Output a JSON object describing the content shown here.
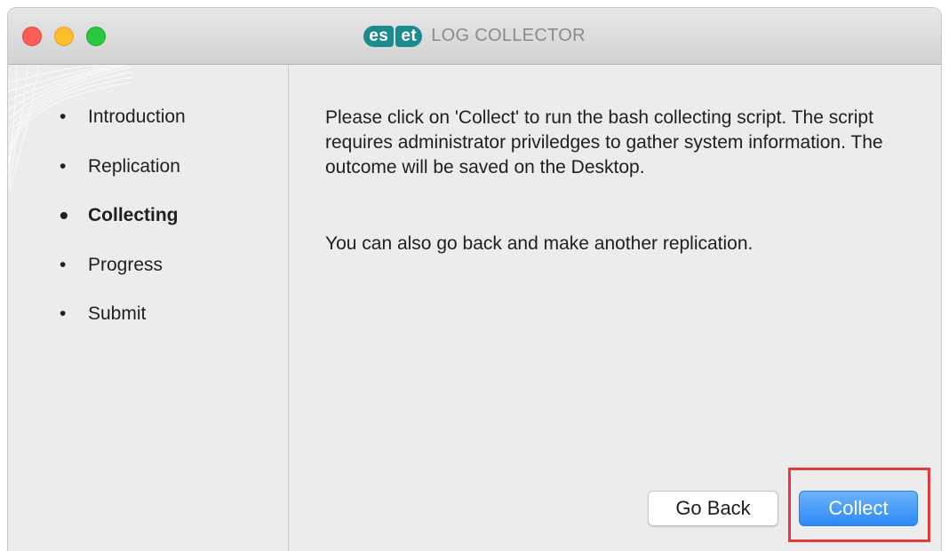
{
  "window": {
    "title": "LOG COLLECTOR",
    "logo": {
      "part1": "es",
      "part2": "et",
      "color": "#1b8b8e"
    }
  },
  "sidebar": {
    "steps": [
      {
        "label": "Introduction",
        "active": false
      },
      {
        "label": "Replication",
        "active": false
      },
      {
        "label": "Collecting",
        "active": true
      },
      {
        "label": "Progress",
        "active": false
      },
      {
        "label": "Submit",
        "active": false
      }
    ]
  },
  "content": {
    "paragraph1": "Please click on 'Collect' to run the bash collecting script. The script requires administrator priviledges to gather system information. The outcome will be saved on the Desktop.",
    "paragraph2": "You can also go back and make another replication."
  },
  "buttons": {
    "back_label": "Go Back",
    "collect_label": "Collect"
  },
  "colors": {
    "accent": "#2d88f6",
    "highlight": "#e63a3a"
  }
}
